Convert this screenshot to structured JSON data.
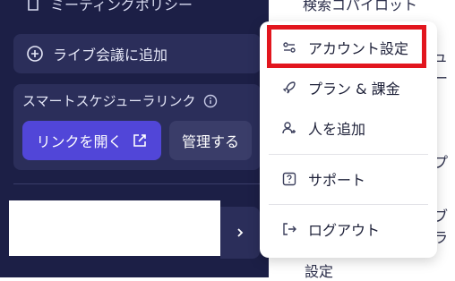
{
  "sidebar": {
    "meeting_policy_label": "ミーティングポリシー",
    "add_live_label": "ライブ会議に追加",
    "smart_link_title": "スマートスケジューラリンク",
    "open_link_label": "リンクを開く",
    "manage_label": "管理する"
  },
  "background": {
    "top_text": "検索コパイロット",
    "frag_1": "ュー",
    "frag_2": "プ",
    "frag_3": "ブラ",
    "frag_4": "設定"
  },
  "menu": {
    "items": [
      {
        "label": "アカウント設定",
        "icon": "settings-sliders-icon"
      },
      {
        "label": "プラン & 課金",
        "icon": "rocket-icon"
      },
      {
        "label": "人を追加",
        "icon": "add-person-icon"
      },
      {
        "label": "サポート",
        "icon": "help-icon"
      },
      {
        "label": "ログアウト",
        "icon": "logout-icon"
      }
    ]
  },
  "colors": {
    "sidebar_bg": "#1c1f46",
    "accent": "#5146d8",
    "highlight": "#e2161e"
  }
}
